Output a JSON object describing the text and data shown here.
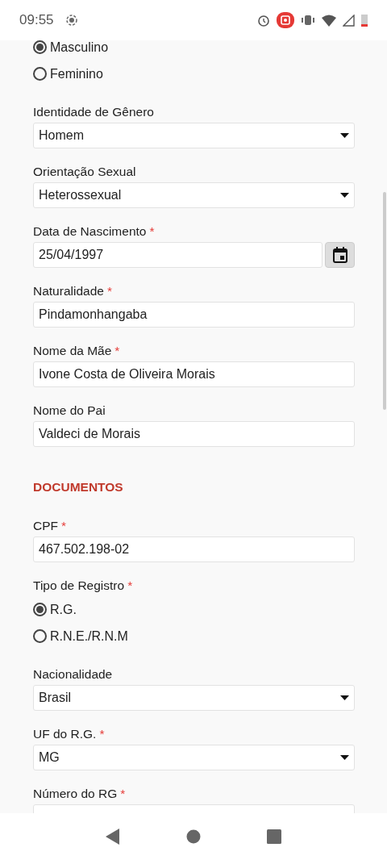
{
  "status_bar": {
    "time": "09:55"
  },
  "form": [
    {
      "kind": "radio",
      "options": [
        {
          "label": "Masculino",
          "selected": true
        },
        {
          "label": "Feminino",
          "selected": false
        }
      ]
    },
    {
      "kind": "select",
      "label": "Identidade de Gênero",
      "value": "Homem"
    },
    {
      "kind": "select",
      "label": "Orientação Sexual",
      "value": "Heterossexual"
    },
    {
      "kind": "date",
      "label": "Data de Nascimento",
      "required_mark": "*",
      "value": "25/04/1997"
    },
    {
      "kind": "text",
      "label": "Naturalidade",
      "required_mark": "*",
      "value": "Pindamonhangaba"
    },
    {
      "kind": "text",
      "label": "Nome da Mãe",
      "required_mark": "*",
      "value": "Ivone Costa de Oliveira Morais"
    },
    {
      "kind": "text",
      "label": "Nome do Pai",
      "value": "Valdeci de Morais"
    },
    {
      "kind": "heading",
      "label": "DOCUMENTOS"
    },
    {
      "kind": "text",
      "label": "CPF",
      "required_mark": "*",
      "value": "467.502.198-02"
    },
    {
      "kind": "radio",
      "label": "Tipo de Registro",
      "required_mark": "*",
      "options": [
        {
          "label": "R.G.",
          "selected": true
        },
        {
          "label": "R.N.E./R.N.M",
          "selected": false
        }
      ]
    },
    {
      "kind": "select",
      "label": "Nacionalidade",
      "value": "Brasil"
    },
    {
      "kind": "select",
      "label": "UF do R.G.",
      "required_mark": "*",
      "value": "MG"
    },
    {
      "kind": "text",
      "label": "Número do RG",
      "required_mark": "*"
    }
  ]
}
